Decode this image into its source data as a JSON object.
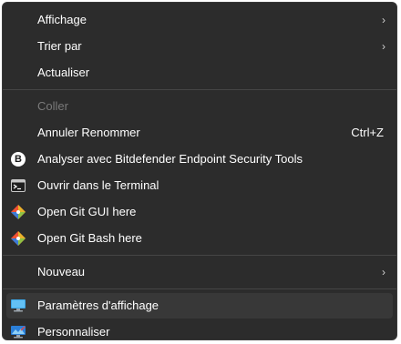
{
  "menu": {
    "items": [
      {
        "label": "Affichage",
        "chevron": "›",
        "icon": ""
      },
      {
        "label": "Trier par",
        "chevron": "›",
        "icon": ""
      },
      {
        "label": "Actualiser",
        "icon": ""
      },
      {
        "label": "Coller",
        "icon": "",
        "disabled": true
      },
      {
        "label": "Annuler Renommer",
        "shortcut": "Ctrl+Z",
        "icon": ""
      },
      {
        "label": "Analyser avec Bitdefender Endpoint Security Tools",
        "icon": "bitdefender-icon",
        "icon_text": "B"
      },
      {
        "label": "Ouvrir dans le Terminal",
        "icon": "terminal-icon"
      },
      {
        "label": "Open Git GUI here",
        "icon": "git-icon"
      },
      {
        "label": "Open Git Bash here",
        "icon": "git-icon"
      },
      {
        "label": "Nouveau",
        "chevron": "›",
        "icon": ""
      },
      {
        "label": "Paramètres d'affichage",
        "icon": "display-settings-icon",
        "hovered": true
      },
      {
        "label": "Personnaliser",
        "icon": "personalize-icon"
      }
    ]
  },
  "colors": {
    "background": "#2c2c2c",
    "hover": "#383838",
    "separator": "#454545",
    "text": "#ffffff",
    "disabled_text": "#7a7a7a"
  }
}
